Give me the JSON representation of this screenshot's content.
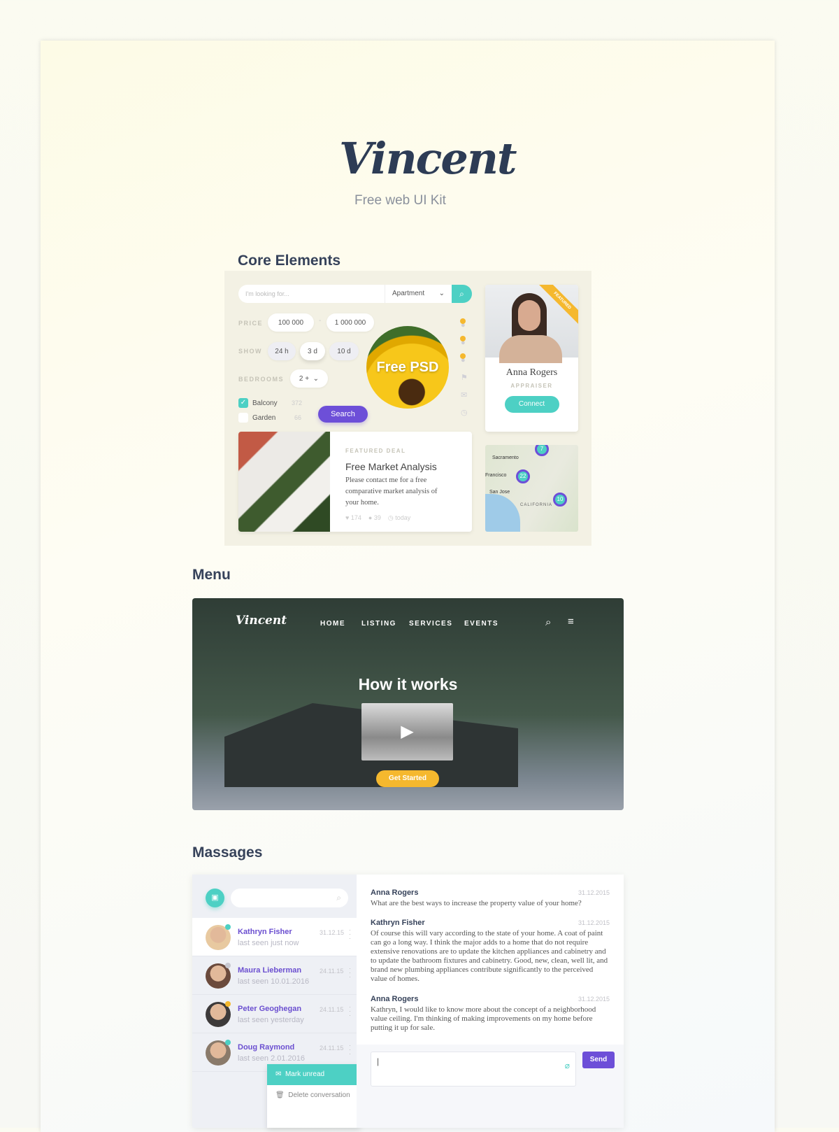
{
  "header": {
    "logo": "Vincent",
    "subtitle": "Free web UI Kit"
  },
  "core": {
    "heading": "Core Elements",
    "search": {
      "placeholder": "I'm looking for...",
      "type": "Apartment"
    },
    "price": {
      "label": "PRICE",
      "min": "100 000",
      "max": "1 000 000",
      "sep": "-"
    },
    "show": {
      "label": "SHOW",
      "options": [
        "24 h",
        "3 d",
        "10 d"
      ],
      "selected": "3 d"
    },
    "bedrooms": {
      "label": "BEDROOMS",
      "value": "2 +"
    },
    "checks": [
      {
        "label": "Balcony",
        "count": "372",
        "checked": true
      },
      {
        "label": "Garden",
        "count": "66",
        "checked": false
      }
    ],
    "search_button": "Search",
    "promo": "Free PSD",
    "profile": {
      "name": "Anna Rogers",
      "role": "APPRAISER",
      "button": "Connect",
      "ribbon": "FEATURED"
    },
    "deal": {
      "eyebrow": "FEATURED DEAL",
      "title": "Free Market Analysis",
      "text": "Please contact me for a free comparative market analysis of your home.",
      "likes": "174",
      "comments": "39",
      "time": "today"
    },
    "map": {
      "labels": [
        "Sacramento",
        "Francisco",
        "San Jose",
        "CALIFORNIA"
      ],
      "pins": [
        "7",
        "22",
        "10"
      ]
    }
  },
  "menu": {
    "heading": "Menu",
    "logo": "Vincent",
    "items": [
      "HOME",
      "LISTING",
      "SERVICES",
      "EVENTS"
    ],
    "title": "How it works",
    "cta": "Get Started"
  },
  "messages": {
    "heading": "Massages",
    "contacts": [
      {
        "name": "Kathryn Fisher",
        "seen": "last seen just now",
        "date": "31.12.15",
        "status": "#4dd0c4"
      },
      {
        "name": "Maura Lieberman",
        "seen": "last seen 10.01.2016",
        "date": "24.11.15",
        "status": "#c8c8d0"
      },
      {
        "name": "Peter Geoghegan",
        "seen": "last seen yesterday",
        "date": "24.11.15",
        "status": "#f5b82e"
      },
      {
        "name": "Doug Raymond",
        "seen": "last seen 2.01.2016",
        "date": "24.11.15",
        "status": "#4dd0c4"
      }
    ],
    "context_menu": [
      "Mark unread",
      "Delete conversation"
    ],
    "thread": [
      {
        "name": "Anna Rogers",
        "date": "31.12.2015",
        "text": "What are the best ways to increase the property value of your home?"
      },
      {
        "name": "Kathryn Fisher",
        "date": "31.12.2015",
        "text": "Of course this will vary according to the state of your home.  A coat of paint can go a long way.  I think the major adds to a home that do not require extensive renovations are to update the kitchen appliances and cabinetry and to update the bathroom fixtures and cabinetry.  Good, new, clean, well lit, and brand new plumbing appliances contribute significantly to the perceived value of homes."
      },
      {
        "name": "Anna Rogers",
        "date": "31.12.2015",
        "text": "Kathryn, I would like to know more about the concept of a neighborhood value ceiling. I'm thinking of making improvements on my home before putting it up for sale."
      }
    ],
    "send": "Send"
  },
  "colors": {
    "teal": "#4dd0c4",
    "purple": "#6d4fd8",
    "yellow": "#f5b82e"
  }
}
